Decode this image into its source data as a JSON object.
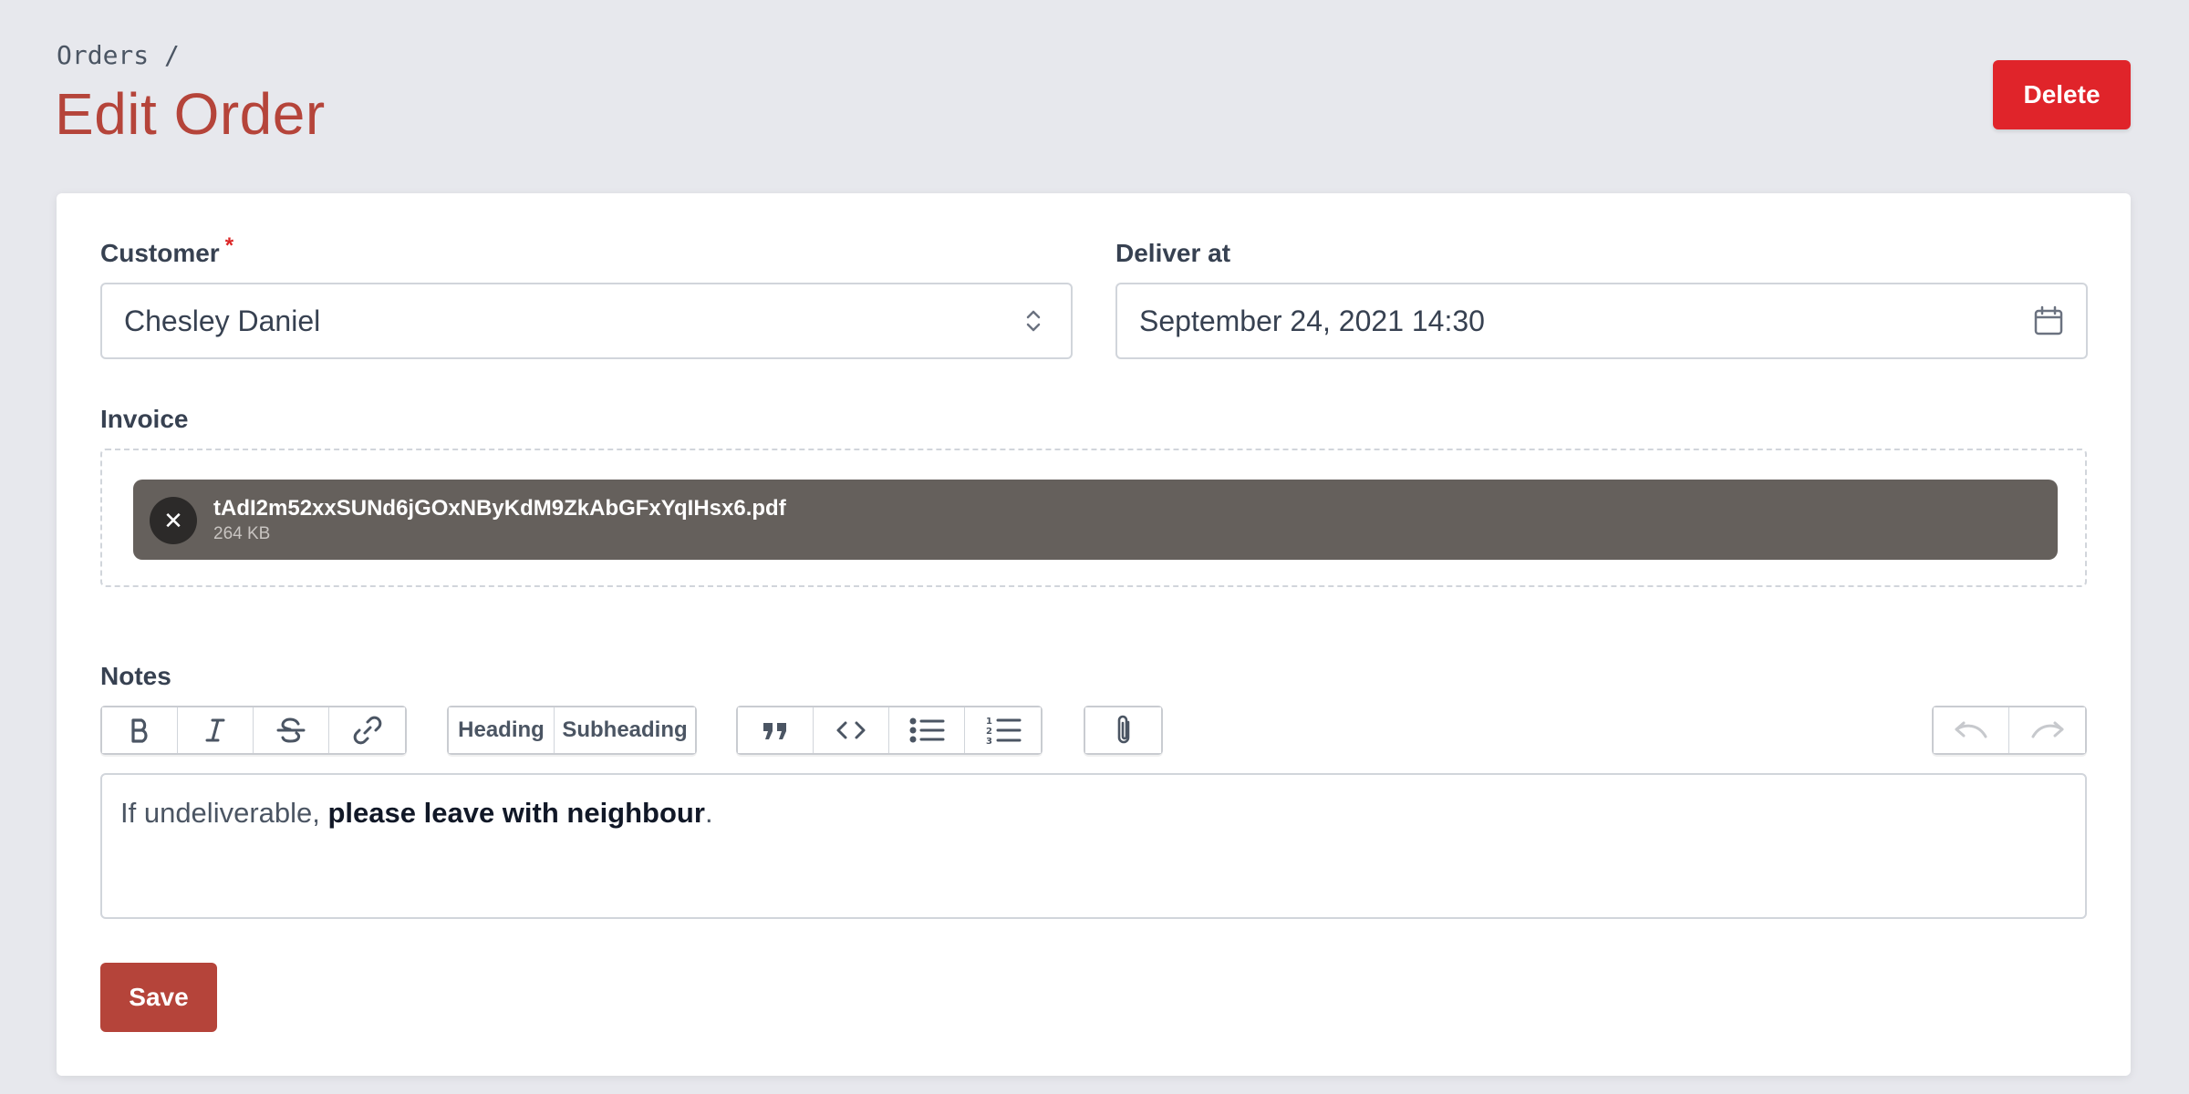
{
  "breadcrumb": "Orders /",
  "page_title": "Edit Order",
  "header": {
    "delete_label": "Delete"
  },
  "form": {
    "customer": {
      "label": "Customer",
      "required_mark": "*",
      "value": "Chesley Daniel"
    },
    "deliver_at": {
      "label": "Deliver at",
      "value": "September 24, 2021 14:30"
    },
    "invoice": {
      "label": "Invoice",
      "file": {
        "name": "tAdI2m52xxSUNd6jGOxNByKdM9ZkAbGFxYqIHsx6.pdf",
        "size": "264 KB"
      }
    },
    "notes": {
      "label": "Notes",
      "toolbar": {
        "heading_label": "Heading",
        "subheading_label": "Subheading"
      },
      "content": {
        "part1": "If undeliverable, ",
        "bold": "please leave with neighbour",
        "part2": "."
      }
    },
    "save_label": "Save"
  },
  "colors": {
    "brand": "#b5443a",
    "danger": "#e0242a",
    "background": "#e7e8ed",
    "file_pill": "#65605c"
  },
  "icons": [
    "select-chevrons-icon",
    "calendar-icon",
    "close-icon",
    "bold-icon",
    "italic-icon",
    "strikethrough-icon",
    "link-icon",
    "quote-icon",
    "code-icon",
    "bullet-list-icon",
    "numbered-list-icon",
    "attach-icon",
    "undo-icon",
    "redo-icon"
  ]
}
